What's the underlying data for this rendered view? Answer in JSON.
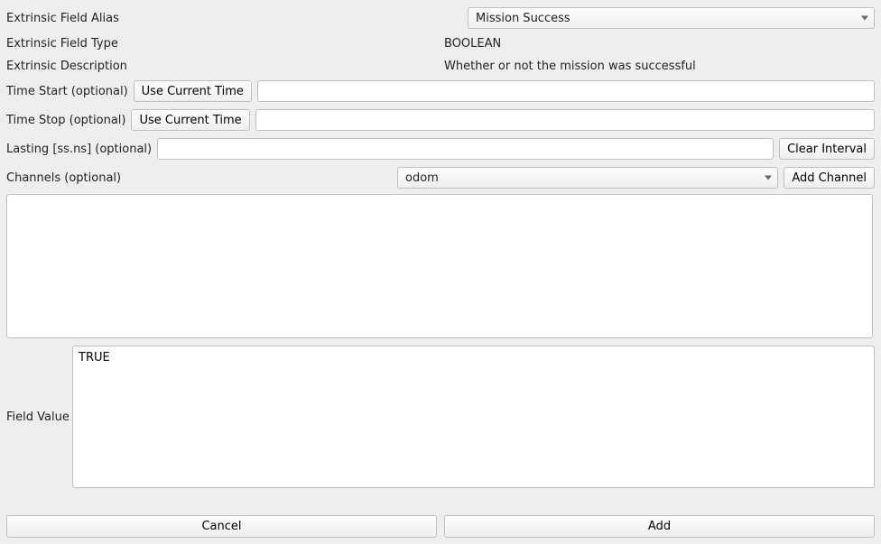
{
  "labels": {
    "alias": "Extrinsic Field Alias",
    "type": "Extrinsic Field Type",
    "desc": "Extrinsic Description",
    "timeStart": "Time Start (optional)",
    "timeStop": "Time Stop (optional)",
    "lasting": "Lasting [ss.ns] (optional)",
    "channels": "Channels (optional)",
    "fieldValue": "Field Value"
  },
  "buttons": {
    "useCurrentTime": "Use Current Time",
    "clearInterval": "Clear Interval",
    "addChannel": "Add Channel",
    "cancel": "Cancel",
    "add": "Add"
  },
  "values": {
    "aliasSelected": "Mission Success",
    "type": "BOOLEAN",
    "desc": "Whether or not the mission was successful",
    "timeStart": "",
    "timeStop": "",
    "lasting": "",
    "channelSelected": "odom",
    "channelsList": "",
    "fieldValue": "TRUE"
  }
}
